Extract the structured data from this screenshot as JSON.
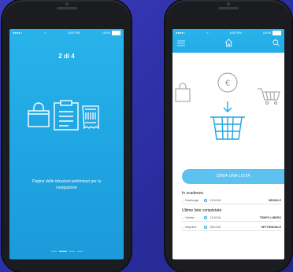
{
  "left_phone": {
    "status": {
      "carrier": "●●●●○",
      "wifi": "≈",
      "time": "6:00 PM",
      "battery": "100%"
    },
    "pager_title": "2 di 4",
    "caption": "Pagine delle istruzioni preliminari per la navigazione",
    "icons": [
      "shopping-bag-icon",
      "clipboard-icon",
      "receipt-icon"
    ]
  },
  "right_phone": {
    "status": {
      "carrier": "●●●●○",
      "wifi": "≈",
      "time": "6:00 PM",
      "battery": "100%"
    },
    "header_icons": [
      "menu-icon",
      "home-icon",
      "search-icon"
    ],
    "illustration_icons": [
      "shopping-bag-icon",
      "euro-coin-icon",
      "cart-icon",
      "down-arrow-icon",
      "basket-icon"
    ],
    "cta_label": "CREA UNA LISTA",
    "in_scadenza_title": "In scadenza",
    "in_scadenza_rows": [
      {
        "name": "Esselunga",
        "date": "21/10/16",
        "type": "MENSILE"
      }
    ],
    "ultime_title": "Ultime liste completate",
    "ultime_rows": [
      {
        "name": "Ulmine",
        "date": "11/10/16",
        "type": "TEMPO LIBERO"
      },
      {
        "name": "Bioprime",
        "date": "28/11/16",
        "type": "SETTIMANALE"
      }
    ]
  },
  "colors": {
    "background": "#2d2fa6",
    "accent": "#1fa6e3",
    "cta": "#5ec2f0"
  }
}
